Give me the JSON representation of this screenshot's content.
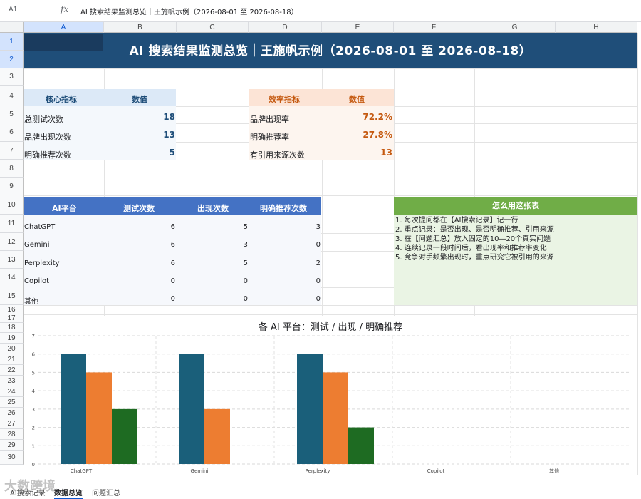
{
  "formula_bar": {
    "cell_ref": "A1",
    "fx": "fx",
    "content": "AI 搜索结果监测总览｜王施帆示例（2026-08-01 至 2026-08-18）"
  },
  "columns": [
    "A",
    "B",
    "C",
    "D",
    "E",
    "F",
    "G",
    "H"
  ],
  "rows": [
    "1",
    "2",
    "3",
    "4",
    "5",
    "6",
    "7",
    "8",
    "9",
    "10",
    "11",
    "12",
    "13",
    "14",
    "15",
    "16",
    "17",
    "18",
    "19",
    "20",
    "21",
    "22",
    "23",
    "24",
    "25",
    "26",
    "27",
    "28",
    "29",
    "30"
  ],
  "title": "AI 搜索结果监测总览｜王施帆示例（2026-08-01 至 2026-08-18）",
  "core": {
    "header_label": "核心指标",
    "header_value": "数值",
    "items": [
      {
        "label": "总测试次数",
        "value": "18"
      },
      {
        "label": "品牌出现次数",
        "value": "13"
      },
      {
        "label": "明确推荐次数",
        "value": "5"
      }
    ]
  },
  "efficiency": {
    "header_label": "效率指标",
    "header_value": "数值",
    "items": [
      {
        "label": "品牌出现率",
        "value": "72.2%"
      },
      {
        "label": "明确推荐率",
        "value": "27.8%"
      },
      {
        "label": "有引用来源次数",
        "value": "13"
      }
    ]
  },
  "platform_table": {
    "headers": [
      "AI平台",
      "测试次数",
      "出现次数",
      "明确推荐次数"
    ],
    "rows": [
      [
        "ChatGPT",
        "6",
        "5",
        "3"
      ],
      [
        "Gemini",
        "6",
        "3",
        "0"
      ],
      [
        "Perplexity",
        "6",
        "5",
        "2"
      ],
      [
        "Copilot",
        "0",
        "0",
        "0"
      ],
      [
        "其他",
        "0",
        "0",
        "0"
      ]
    ]
  },
  "howto": {
    "title": "怎么用这张表",
    "lines": [
      "1. 每次提问都在【AI搜索记录】记一行",
      "2. 重点记录：是否出现、是否明确推荐、引用来源",
      "3. 在【问题汇总】放入固定的10—20个真实问题",
      "4. 连续记录一段时间后，看出现率和推荐率变化",
      "5. 竞争对手频繁出现时，重点研究它被引用的来源"
    ]
  },
  "colors": {
    "title_bg": "#1f4e79",
    "core_header_bg": "#dce9f7",
    "eff_header_bg": "#fce4d6",
    "table_header_bg": "#4472c4",
    "howto_header_bg": "#70ad47",
    "series_test": "#1a5f7a",
    "series_appear": "#ed7d31",
    "series_recommend": "#1e6b22"
  },
  "chart_data": {
    "type": "bar",
    "title": "各 AI 平台：测试 / 出现 / 明确推荐",
    "categories": [
      "ChatGPT",
      "Gemini",
      "Perplexity",
      "Copilot",
      "其他"
    ],
    "series": [
      {
        "values": [
          6,
          6,
          6,
          0,
          0
        ],
        "color": "#1a5f7a"
      },
      {
        "values": [
          5,
          3,
          5,
          0,
          0
        ],
        "color": "#ed7d31"
      },
      {
        "values": [
          3,
          0,
          2,
          0,
          0
        ],
        "color": "#1e6b22"
      }
    ],
    "ylim": [
      0,
      7
    ],
    "yticks": [
      "0",
      "1",
      "2",
      "3",
      "4",
      "5",
      "6",
      "7"
    ],
    "grid": true,
    "legend": "none"
  },
  "sheet_tabs": [
    "AI搜索记录",
    "数据总览",
    "问题汇总"
  ],
  "watermark": "大数跨境"
}
